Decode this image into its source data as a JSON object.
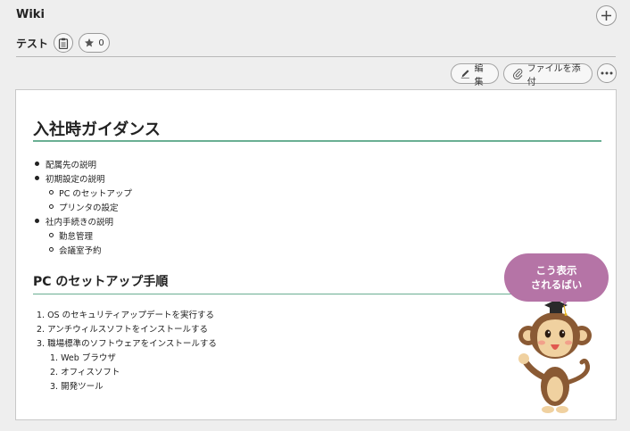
{
  "header": {
    "title": "Wiki"
  },
  "page": {
    "title": "テスト",
    "star_count": "0"
  },
  "toolbar": {
    "edit_label": "編集",
    "attach_label": "ファイルを添付"
  },
  "article": {
    "h1": "入社時ガイダンス",
    "list1": [
      {
        "text": "配属先の説明",
        "marker": "disc"
      },
      {
        "text": "初期設定の説明",
        "marker": "disc"
      },
      {
        "text": "PC のセットアップ",
        "marker": "circle"
      },
      {
        "text": "プリンタの設定",
        "marker": "circle"
      },
      {
        "text": "社内手続きの説明",
        "marker": "disc"
      },
      {
        "text": "勤怠管理",
        "marker": "circle"
      },
      {
        "text": "会議室予約",
        "marker": "circle"
      }
    ],
    "h2": "PC のセットアップ手順",
    "list2": [
      "1. OS のセキュリティアップデートを実行する",
      "2. アンチウィルスソフトをインストールする",
      "3. 職場標準のソフトウェアをインストールする",
      "1. Web ブラウザ",
      "2. オフィスソフト",
      "3. 開発ツール"
    ]
  },
  "mascot": {
    "line1": "こう表示",
    "line2": "されるばい"
  },
  "icons": {
    "add": "plus-icon",
    "clip": "clipboard-icon",
    "star": "star-icon",
    "edit": "pencil-icon",
    "attach": "paperclip-icon",
    "more": "more-icon"
  },
  "colors": {
    "heading_rule": "#6aaf93",
    "bubble": "#b574a6"
  }
}
